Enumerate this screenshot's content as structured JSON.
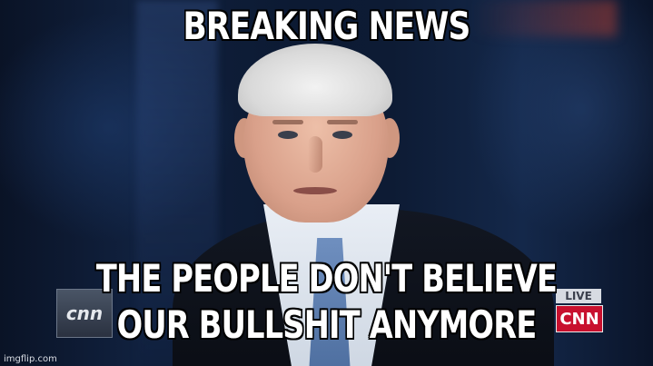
{
  "meme": {
    "top_text": "BREAKING NEWS",
    "bottom_text_line1": "THE PEOPLE DON'T BELIEVE",
    "bottom_text_line2": "OUR BULLSHIT ANYMORE"
  },
  "broadcast": {
    "left_logo": "cnn",
    "live_label": "LIVE",
    "network_logo": "CNN"
  },
  "watermark": "imgflip.com",
  "colors": {
    "caption_fill": "#ffffff",
    "caption_stroke": "#000000",
    "network_red": "#c8102e"
  }
}
